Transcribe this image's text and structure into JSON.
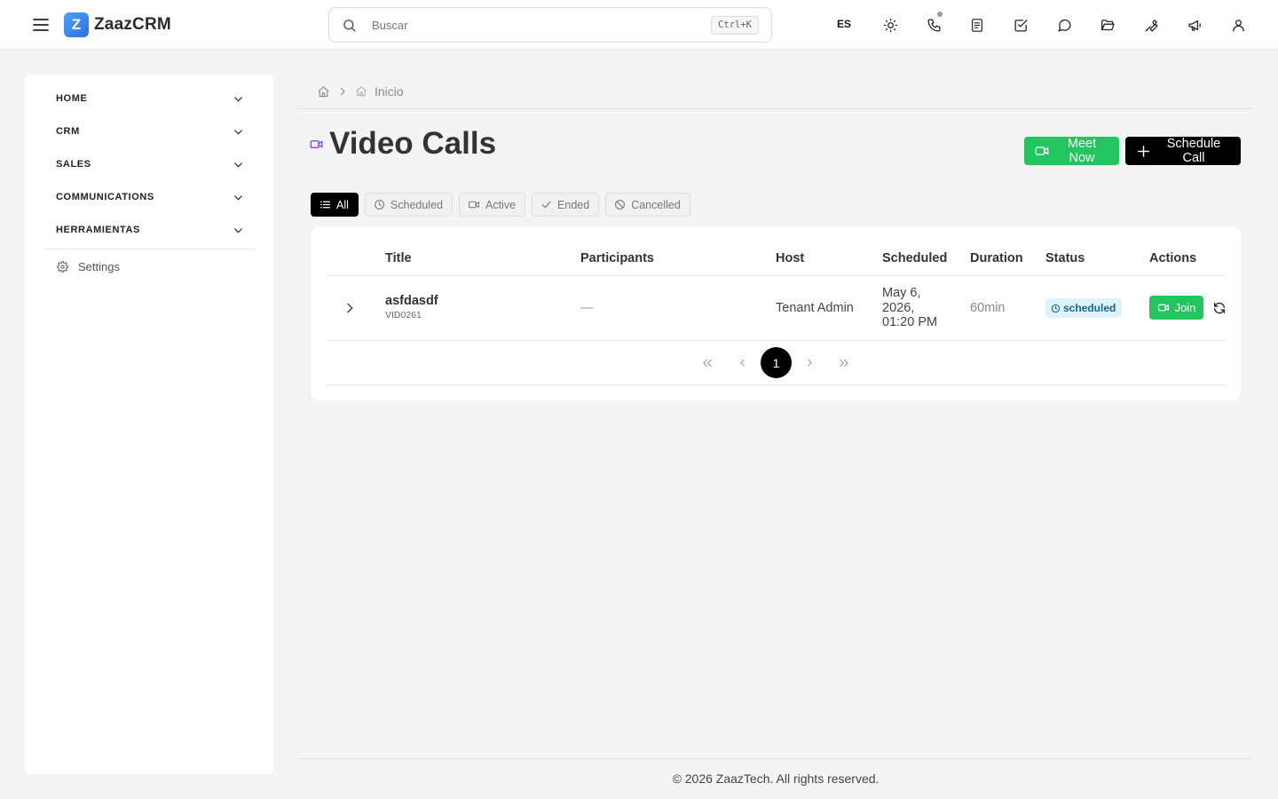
{
  "app": {
    "name": "ZaazCRM",
    "logo_letter": "Z"
  },
  "header": {
    "search": {
      "placeholder": "Buscar",
      "shortcut": "Ctrl+K"
    },
    "language": "ES",
    "icons": [
      "theme-icon",
      "phone-icon",
      "notes-icon",
      "tasks-icon",
      "chat-icon",
      "folder-icon",
      "tools-icon",
      "megaphone-icon",
      "user-icon"
    ]
  },
  "sidebar": {
    "items": [
      {
        "label": "HOME"
      },
      {
        "label": "CRM"
      },
      {
        "label": "SALES"
      },
      {
        "label": "COMMUNICATIONS"
      },
      {
        "label": "HERRAMIENTAS"
      }
    ],
    "settings_label": "Settings"
  },
  "breadcrumb": {
    "current": "Inicio"
  },
  "page": {
    "title": "Video Calls",
    "buttons": {
      "meet_now": "Meet Now",
      "schedule_call": "Schedule Call"
    },
    "filters": [
      {
        "label": "All",
        "active": true
      },
      {
        "label": "Scheduled",
        "active": false
      },
      {
        "label": "Active",
        "active": false
      },
      {
        "label": "Ended",
        "active": false
      },
      {
        "label": "Cancelled",
        "active": false
      }
    ]
  },
  "table": {
    "columns": [
      "Title",
      "Participants",
      "Host",
      "Scheduled",
      "Duration",
      "Status",
      "Actions"
    ],
    "rows": [
      {
        "title": "asfdasdf",
        "code": "VID0261",
        "participants": "—",
        "host": "Tenant Admin",
        "scheduled_1": "May 6,",
        "scheduled_2": "2026,",
        "scheduled_3": "01:20 PM",
        "duration": "60min",
        "status": "scheduled",
        "join_label": "Join"
      }
    ],
    "pagination": {
      "current_page": "1"
    }
  },
  "colors": {
    "accent_green": "#22c55e",
    "primary_black": "#000000",
    "status_bg": "#dff1fb",
    "status_text": "#0b6a96"
  },
  "footer": {
    "text": "© 2026 ZaazTech. All rights reserved."
  }
}
